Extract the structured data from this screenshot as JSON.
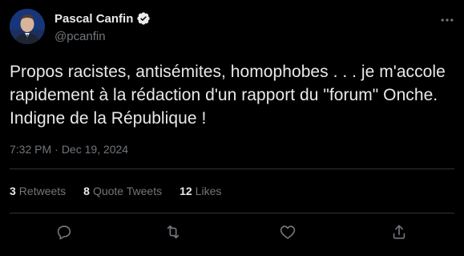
{
  "author": {
    "display_name": "Pascal Canfin",
    "handle": "@pcanfin",
    "verified": true
  },
  "tweet": {
    "text": "Propos racistes, antisémites, homophobes . . . je m'accole rapidement à la rédaction d'un rapport du \"forum\" Onche. Indigne de la République !",
    "time": "7:32 PM",
    "separator": "·",
    "date": "Dec 19, 2024"
  },
  "stats": {
    "retweets_count": "3",
    "retweets_label": "Retweets",
    "quotes_count": "8",
    "quotes_label": "Quote Tweets",
    "likes_count": "12",
    "likes_label": "Likes"
  },
  "icons": {
    "more": "more-icon",
    "reply": "reply-icon",
    "retweet": "retweet-icon",
    "like": "like-icon",
    "share": "share-icon",
    "verified": "verified-badge-icon"
  },
  "colors": {
    "background": "#000000",
    "text_primary": "#e7e9ea",
    "text_secondary": "#71767b",
    "divider": "#2f3336"
  }
}
